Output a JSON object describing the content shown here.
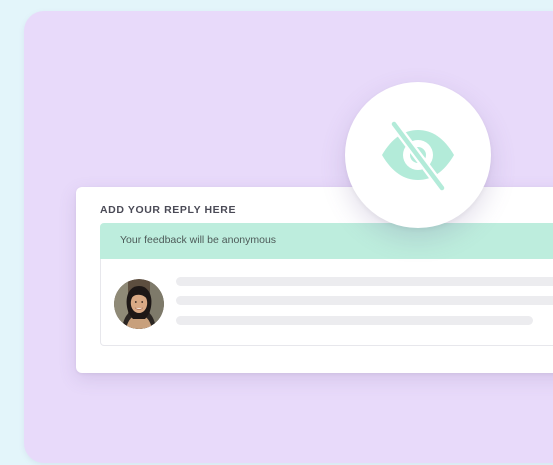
{
  "reply_card": {
    "heading": "ADD YOUR REPLY HERE",
    "anonymity_notice": "Your feedback will be anonymous"
  },
  "icons": {
    "badge_icon": "eye-slash-icon",
    "avatar": "user-avatar-photo"
  },
  "colors": {
    "background": "#e3f5fa",
    "panel": "#e8dafa",
    "notice_bar": "#bdeddd",
    "eye_icon": "#b3ebd9",
    "placeholder_line": "#ececef"
  }
}
